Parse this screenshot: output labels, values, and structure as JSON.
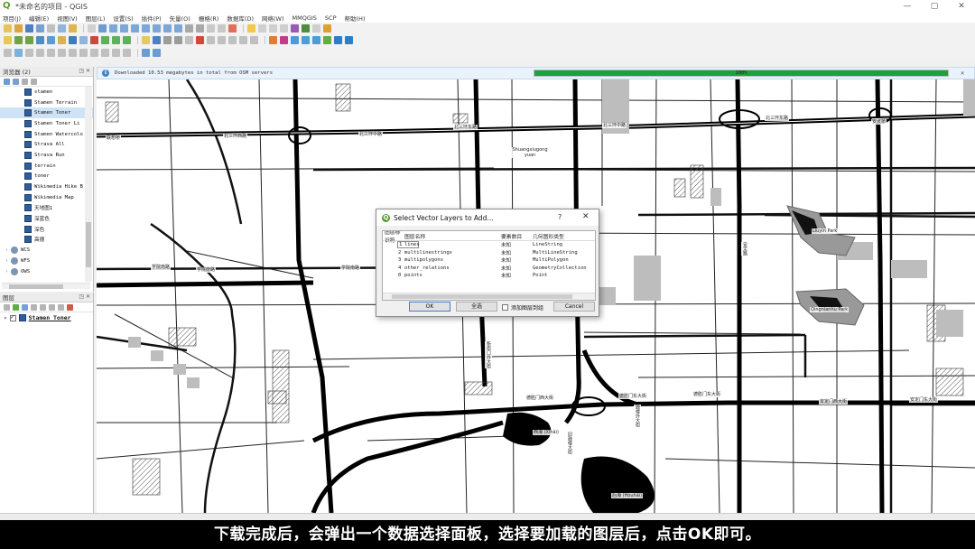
{
  "window": {
    "title": "*未命名的项目 - QGIS",
    "controls": [
      "—",
      "▢",
      "✕"
    ]
  },
  "menubar": [
    "项目(J)",
    "编辑(E)",
    "视图(V)",
    "图层(L)",
    "设置(S)",
    "插件(P)",
    "矢量(O)",
    "栅格(R)",
    "数据库(D)",
    "网络(W)",
    "MMQGIS",
    "SCP",
    "帮助(H)"
  ],
  "browser_panel": {
    "title": "浏览器 (2)",
    "items": [
      {
        "label": "stamen",
        "selected": false
      },
      {
        "label": "Stamen Terrain",
        "selected": false
      },
      {
        "label": "Stamen Toner",
        "selected": true
      },
      {
        "label": "Stamen Toner Li",
        "selected": false
      },
      {
        "label": "Stamen Watercolo",
        "selected": false
      },
      {
        "label": "Strava All",
        "selected": false
      },
      {
        "label": "Strava Run",
        "selected": false
      },
      {
        "label": "terrain",
        "selected": false
      },
      {
        "label": "toner",
        "selected": false
      },
      {
        "label": "Wikimedia Hike B",
        "selected": false
      },
      {
        "label": "Wikimedia Map",
        "selected": false
      },
      {
        "label": "天地图1",
        "selected": false
      },
      {
        "label": "深蓝色",
        "selected": false
      },
      {
        "label": "深色",
        "selected": false
      },
      {
        "label": "高德",
        "selected": false
      }
    ],
    "groups": [
      {
        "label": "WCS",
        "icon": "globe-icon"
      },
      {
        "label": "WFS",
        "icon": "globe-icon"
      },
      {
        "label": "OWS",
        "icon": "globe-icon"
      }
    ]
  },
  "layers_panel": {
    "title": "图层",
    "layers": [
      {
        "label": "Stamen Toner",
        "checked": true
      }
    ]
  },
  "message_bar": {
    "text": "Downloaded 10.53 megabytes in total from OSM servers",
    "progress_percent": 100,
    "progress_text": "100%"
  },
  "map": {
    "labels": [
      {
        "text": "北三环西路"
      },
      {
        "text": "北三环中路"
      },
      {
        "text": "北三环东路"
      },
      {
        "text": "北三环中路"
      },
      {
        "text": "北三环东路"
      },
      {
        "text": "联想桥"
      },
      {
        "text": "安贞桥"
      },
      {
        "text": "学院南路"
      },
      {
        "text": "学院南路"
      },
      {
        "text": "学院南路"
      },
      {
        "text": "德胜门西大街"
      },
      {
        "text": "德胜门东大街"
      },
      {
        "text": "德胜门东大街"
      },
      {
        "text": "安定门西大街"
      },
      {
        "text": "安定门东大街"
      },
      {
        "text": "新街口外大街"
      },
      {
        "text": "旧鼓楼大街"
      },
      {
        "text": "鼓楼外大街"
      },
      {
        "text": "安定路"
      },
      {
        "text": "Shuangxiugong yuan"
      },
      {
        "text": "Liuyin Park"
      },
      {
        "text": "Qingnianhu Park"
      },
      {
        "text": "西海 (Xīhǎi)"
      },
      {
        "text": "后海 (Hòuhǎi)"
      }
    ]
  },
  "dialog": {
    "title": "Select Vector Layers to Add...",
    "help": "?",
    "close": "✕",
    "columns": [
      "图层标识符",
      "图层名称",
      "要素数目",
      "几何图形类型"
    ],
    "rows": [
      {
        "id": "1",
        "name": "lines",
        "count": "未知",
        "geometry": "LineString"
      },
      {
        "id": "2",
        "name": "multilinestrings",
        "count": "未知",
        "geometry": "MultiLineString"
      },
      {
        "id": "3",
        "name": "multipolygons",
        "count": "未知",
        "geometry": "MultiPolygon"
      },
      {
        "id": "4",
        "name": "other_relations",
        "count": "未知",
        "geometry": "GeometryCollection"
      },
      {
        "id": "0",
        "name": "points",
        "count": "未知",
        "geometry": "Point"
      }
    ],
    "ok_label": "OK",
    "select_all_label": "全选",
    "add_to_group_label": "添加图层到组",
    "cancel_label": "Cancel"
  },
  "caption": "下载完成后，会弹出一个数据选择面板，选择要加载的图层后，点击OK即可。",
  "colors": {
    "accent": "#1aa33a",
    "qgis_green": "#5a9a2c",
    "selection": "#cfe3f7"
  }
}
